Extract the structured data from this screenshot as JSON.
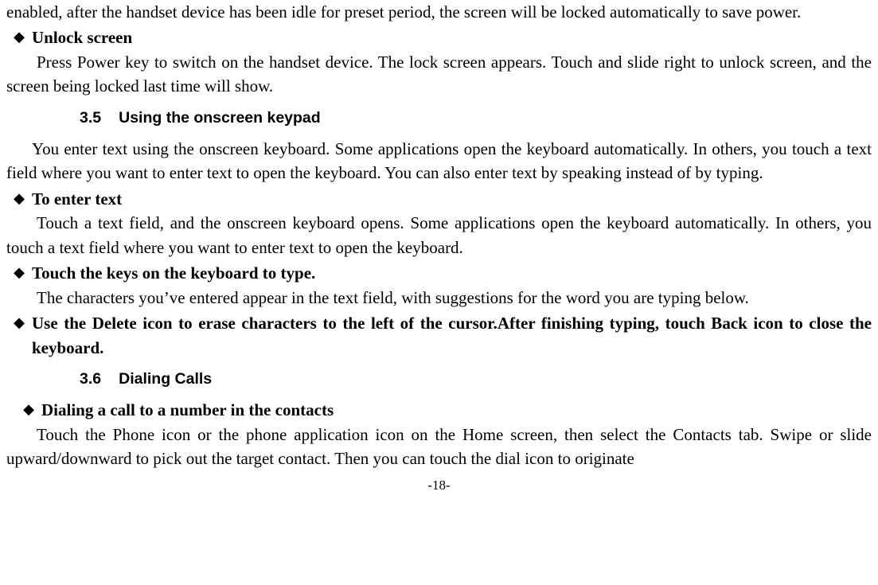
{
  "intro_paragraph": "enabled, after the handset device has been idle for preset period, the screen will be locked automatically to save power.",
  "bullets": {
    "unlock_screen": "Unlock screen",
    "to_enter_text": "To enter text",
    "touch_keys": "Touch the keys on the keyboard to type.",
    "use_delete": "Use the Delete icon to erase characters to the left of the cursor.After finishing typing, touch Back icon to close the keyboard.",
    "dialing_contacts": "Dialing a call to a number in the contacts"
  },
  "unlock_body": "Press Power key to switch on the handset device. The lock screen appears. Touch and slide right to unlock screen, and the screen being locked last time will show.",
  "heading_35_num": "3.5",
  "heading_35_text": "Using the onscreen keypad",
  "onscreen_intro": "You enter text using the onscreen keyboard. Some applications open the keyboard automatically. In others, you touch a text field where you want to enter text to open the keyboard. You can also enter text by speaking instead of by typing.",
  "enter_text_body": "Touch a text field, and the onscreen keyboard opens. Some applications open the keyboard automatically. In others, you touch a text field where you want to enter text to open the keyboard.",
  "touch_keys_body": "The characters you’ve entered appear in the text field, with suggestions for the word you are typing below.",
  "heading_36_num": "3.6",
  "heading_36_text": "Dialing Calls",
  "dialing_body": "Touch the Phone icon or the phone application icon on the Home screen, then select the Contacts tab. Swipe or slide upward/downward to pick out the target contact. Then you can touch the dial icon to originate",
  "page_number": "-18-",
  "diamond": "◆"
}
